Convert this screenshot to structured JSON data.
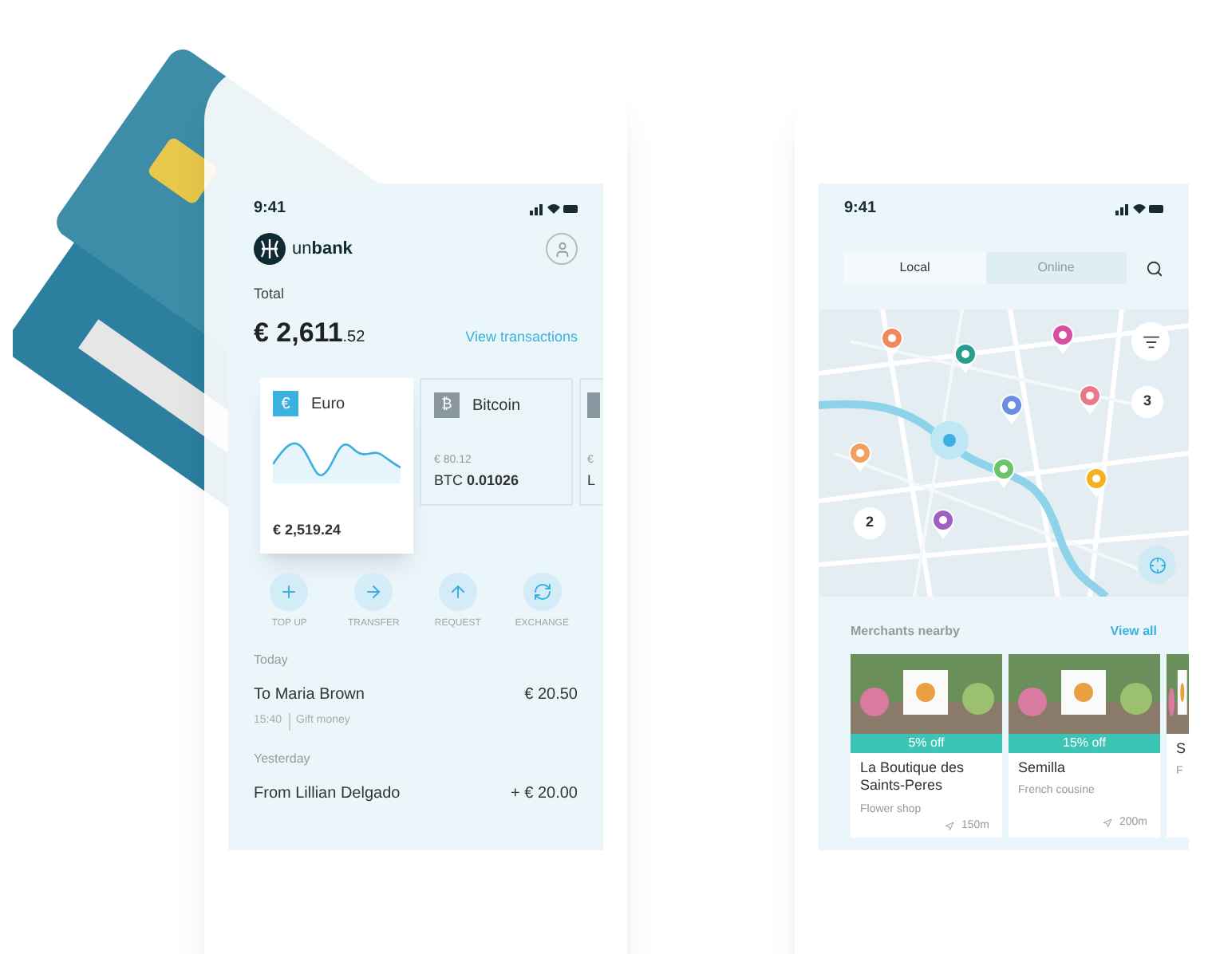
{
  "wallet": {
    "status_time": "9:41",
    "brand": {
      "light": "un",
      "bold": "bank"
    },
    "total_label": "Total",
    "total_main": "€ 2,611",
    "total_cents": ".52",
    "view_link": "View transactions",
    "accounts": [
      {
        "kind": "chart",
        "symbol": "€",
        "name": "Euro",
        "amount": "€ 2,519.24",
        "selected": true
      },
      {
        "kind": "crypto",
        "symbol": "₿",
        "name": "Bitcoin",
        "fiat": "€ 80.12",
        "unit": "BTC",
        "value": "0.01026",
        "selected": false
      },
      {
        "kind": "partial",
        "fiat": "€",
        "unit": "L",
        "selected": false
      }
    ],
    "actions": [
      {
        "kind": "plus",
        "label": "TOP UP"
      },
      {
        "kind": "arrow-right",
        "label": "TRANSFER"
      },
      {
        "kind": "arrow-up",
        "label": "REQUEST"
      },
      {
        "kind": "refresh",
        "label": "EXCHANGE"
      }
    ],
    "groups": [
      {
        "heading": "Today",
        "items": [
          {
            "title": "To Maria Brown",
            "amount": "€ 20.50",
            "time": "15:40",
            "note": "Gift money"
          }
        ]
      },
      {
        "heading": "Yesterday",
        "items": [
          {
            "title": "From Lillian Delgado",
            "amount": "+ € 20.00"
          }
        ]
      }
    ]
  },
  "merchants": {
    "status_time": "9:41",
    "tabs": [
      {
        "label": "Local",
        "selected": true
      },
      {
        "label": "Online",
        "selected": false
      }
    ],
    "clusters": [
      "3",
      "2"
    ],
    "section_title": "Merchants nearby",
    "view_all": "View all",
    "cards": [
      {
        "discount": "5% off",
        "name": "La Boutique des Saints-Peres",
        "category": "Flower shop",
        "distance": "150m"
      },
      {
        "discount": "15% off",
        "name": "Semilla",
        "category": "French cousine",
        "distance": "200m"
      },
      {
        "name": "S",
        "category": "F"
      }
    ]
  }
}
